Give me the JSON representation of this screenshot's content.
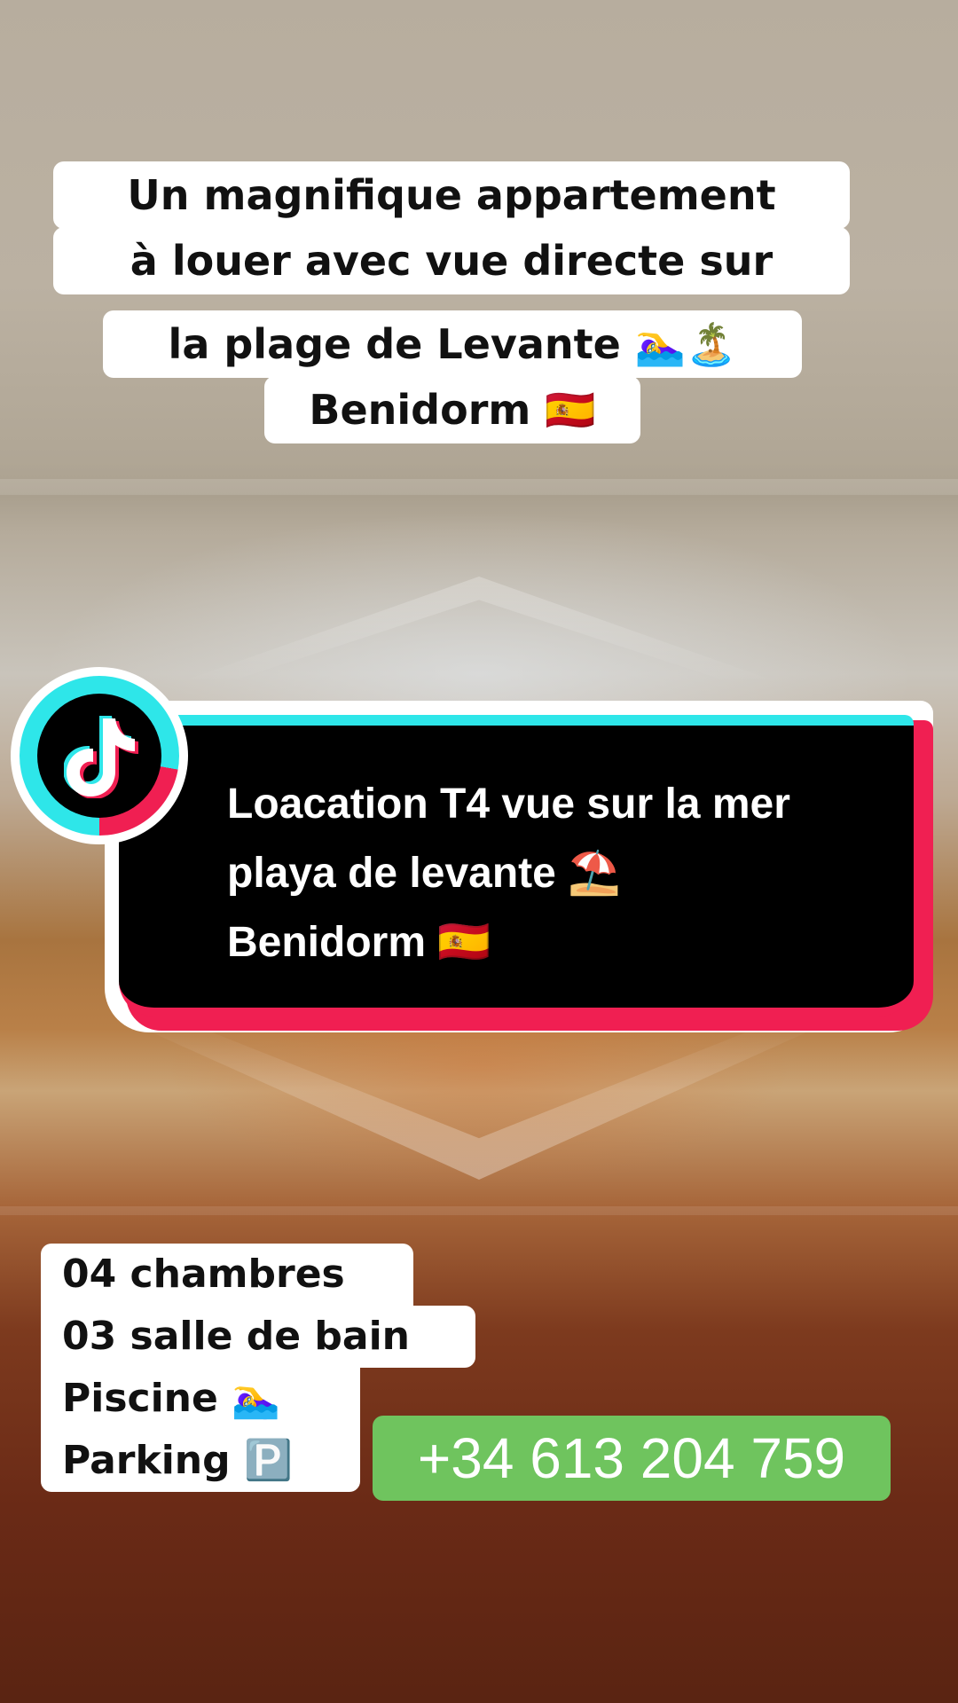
{
  "caption": {
    "lines": [
      "Un magnifique appartement",
      "à louer avec vue directe sur",
      "la plage de Levante 🏊‍♀️🏝️",
      "Benidorm 🇪🇸"
    ]
  },
  "card": {
    "lines": [
      "Loacation T4 vue sur la mer",
      "playa de levante ⛱️",
      "Benidorm 🇪🇸"
    ],
    "logo_icon": "tiktok-logo-icon",
    "colors": {
      "cyan": "#2ee6e9",
      "red": "#f01f52"
    }
  },
  "info": {
    "lines": [
      "04 chambres",
      "03 salle de bain",
      "Piscine 🏊‍♀️",
      "Parking 🅿️"
    ]
  },
  "phone": {
    "number": "+34 613 204 759",
    "color": "#6fc45e"
  }
}
